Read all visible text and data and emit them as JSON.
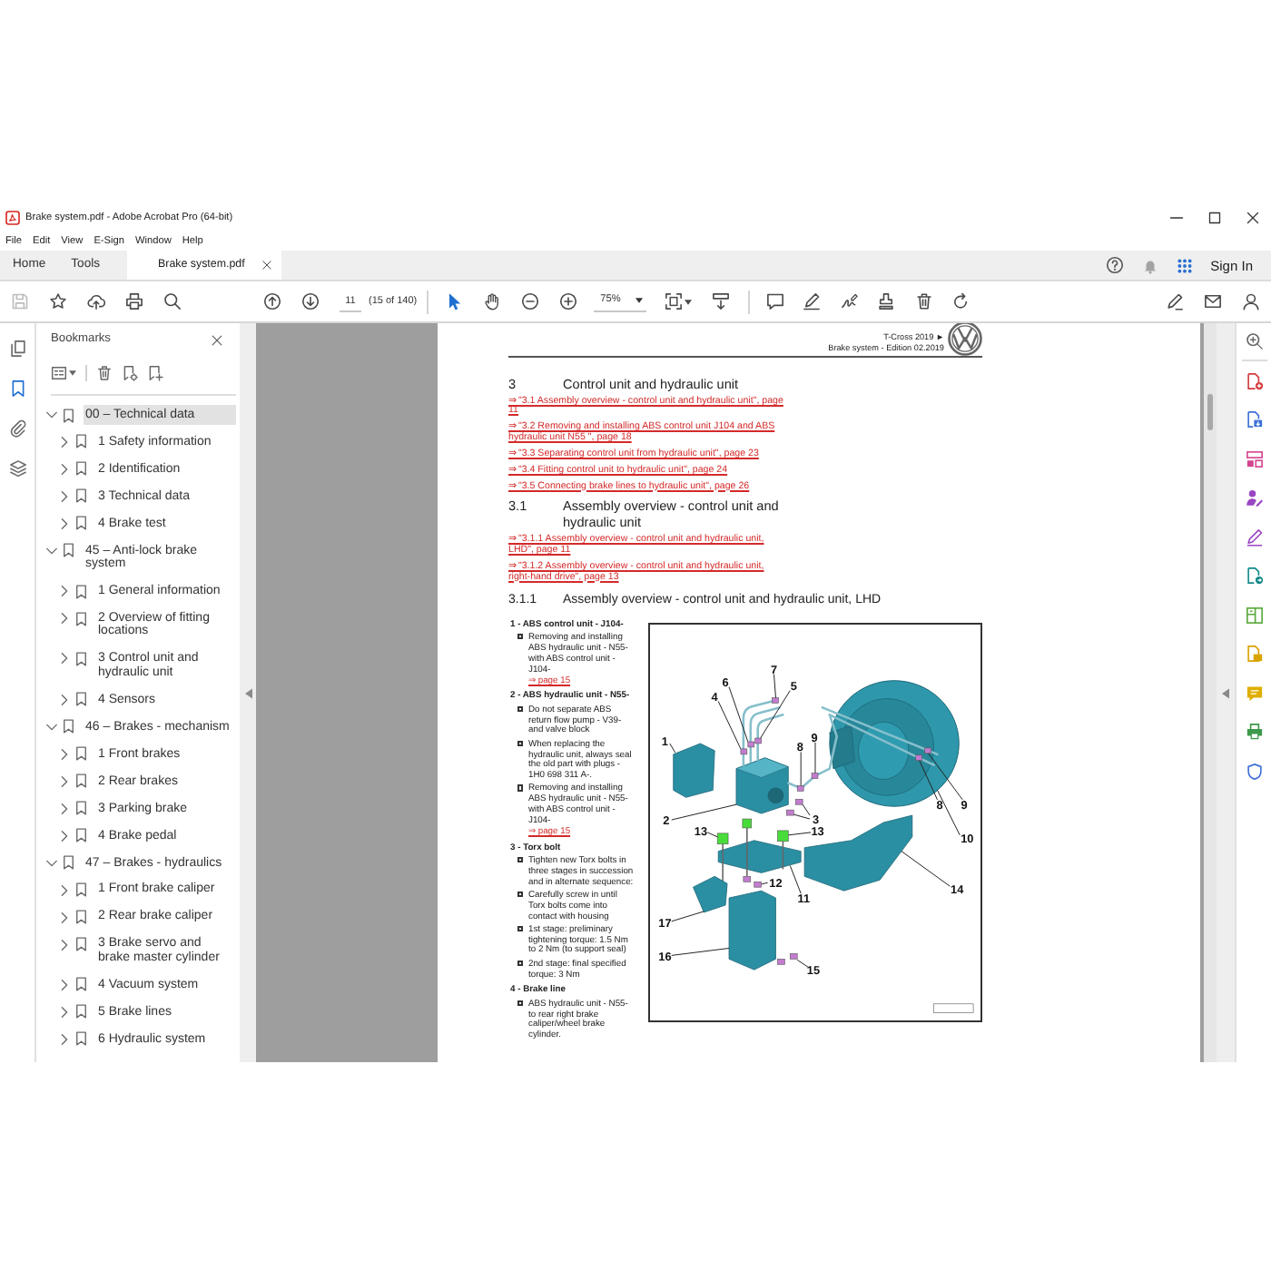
{
  "window": {
    "title": "Brake system.pdf - Adobe Acrobat Pro (64-bit)"
  },
  "menu": [
    "File",
    "Edit",
    "View",
    "E-Sign",
    "Window",
    "Help"
  ],
  "tabs": [
    {
      "label": "Home",
      "kind": "nav",
      "selected": false
    },
    {
      "label": "Tools",
      "kind": "nav",
      "selected": false
    },
    {
      "label": "Brake system.pdf",
      "kind": "document",
      "selected": true
    }
  ],
  "account": {
    "sign_in": "Sign In"
  },
  "toolbar": {
    "save": {
      "disabled": true
    },
    "page": {
      "current": "11",
      "count": "(15 of 140)"
    },
    "tools": {
      "select": {
        "selected": true
      },
      "hand": {
        "selected": false
      }
    },
    "zoom": "75%"
  },
  "side_rail": {
    "pages": {
      "selected": false
    },
    "bookmarks": {
      "selected": true
    },
    "attachments": {
      "selected": false
    },
    "layers": {
      "selected": false
    }
  },
  "bookmarks": {
    "title": "Bookmarks",
    "items": [
      {
        "label": "00 – Technical data",
        "selected": true,
        "expanded": true,
        "children": [
          {
            "label": "1 Safety information",
            "selected": false,
            "expanded": false
          },
          {
            "label": "2 Identification",
            "selected": false,
            "expanded": false
          },
          {
            "label": "3 Technical data",
            "selected": false,
            "expanded": false
          },
          {
            "label": "4 Brake test",
            "selected": false,
            "expanded": false
          }
        ]
      },
      {
        "label": "45 – Anti-lock brake system",
        "selected": false,
        "expanded": true,
        "children": [
          {
            "label": "1 General information",
            "selected": false,
            "expanded": false
          },
          {
            "label": "2 Overview of fitting locations",
            "selected": false,
            "expanded": false
          },
          {
            "label": "3 Control unit and hydraulic unit",
            "selected": false,
            "expanded": false
          },
          {
            "label": "4 Sensors",
            "selected": false,
            "expanded": false
          }
        ]
      },
      {
        "label": "46 – Brakes - mechanism",
        "selected": false,
        "expanded": true,
        "children": [
          {
            "label": "1 Front brakes",
            "selected": false,
            "expanded": false
          },
          {
            "label": "2 Rear brakes",
            "selected": false,
            "expanded": false
          },
          {
            "label": "3 Parking brake",
            "selected": false,
            "expanded": false
          },
          {
            "label": "4 Brake pedal",
            "selected": false,
            "expanded": false
          }
        ]
      },
      {
        "label": "47 – Brakes - hydraulics",
        "selected": false,
        "expanded": true,
        "children": [
          {
            "label": "1 Front brake caliper",
            "selected": false,
            "expanded": false
          },
          {
            "label": "2 Rear brake caliper",
            "selected": false,
            "expanded": false
          },
          {
            "label": "3 Brake servo and brake master cylinder",
            "selected": false,
            "expanded": false
          },
          {
            "label": "4 Vacuum system",
            "selected": false,
            "expanded": false
          },
          {
            "label": "5 Brake lines",
            "selected": false,
            "expanded": false
          },
          {
            "label": "6 Hydraulic system",
            "selected": false,
            "expanded": false
          }
        ]
      }
    ]
  },
  "document": {
    "header": {
      "model": "T-Cross 2019 ►",
      "edition": "Brake system - Edition 02.2019"
    },
    "blocks": [
      {
        "kind": "section_heading",
        "number": "3",
        "text": "Control unit and hydraulic unit"
      },
      {
        "kind": "link",
        "text": "⇒ \"3.1 Assembly overview - control unit and hydraulic unit\", page 11"
      },
      {
        "kind": "link",
        "text": "⇒ \"3.2 Removing and installing ABS control unit J104 and ABS hydraulic unit N55 \", page 18"
      },
      {
        "kind": "link",
        "text": "⇒ \"3.3 Separating control unit from hydraulic unit\", page 23"
      },
      {
        "kind": "link",
        "text": "⇒ \"3.4 Fitting control unit to hydraulic unit\", page 24"
      },
      {
        "kind": "link",
        "text": "⇒ \"3.5 Connecting brake lines to hydraulic unit\", page 26"
      },
      {
        "kind": "section_heading",
        "number": "3.1",
        "text": "Assembly overview - control unit and hydraulic unit"
      },
      {
        "kind": "link",
        "text": "⇒ \"3.1.1 Assembly overview - control unit and hydraulic unit, LHD\", page 11"
      },
      {
        "kind": "link",
        "text": "⇒ \"3.1.2 Assembly overview - control unit and hydraulic unit, right-hand drive\", page 13"
      },
      {
        "kind": "figure_heading",
        "number": "3.1.1",
        "text": "Assembly overview - control unit and hydraulic unit, LHD"
      }
    ],
    "legend": [
      {
        "title": "1 - ABS control unit - J104-",
        "notes": [
          {
            "text": "Removing and installing ABS hydraulic unit - N55- with ABS control unit - J104-",
            "link": "⇒ page 15"
          }
        ]
      },
      {
        "title": "2 - ABS hydraulic unit - N55-",
        "notes": [
          {
            "text": "Do not separate ABS return flow pump - V39- and valve block"
          },
          {
            "text": "When replacing the hydraulic unit, always seal the old part with plugs - 1H0 698 311 A-."
          },
          {
            "text": "Removing and installing ABS hydraulic unit - N55- with ABS control unit - J104-",
            "link": "⇒ page 15"
          }
        ]
      },
      {
        "title": "3 - Torx bolt",
        "notes": [
          {
            "text": "Tighten new Torx bolts in three stages in succession and in alternate sequence:"
          },
          {
            "text": "Carefully screw in until Torx bolts come into contact with housing"
          },
          {
            "text": "1st stage: preliminary tightening torque: 1.5 Nm to 2 Nm (to support seal)"
          },
          {
            "text": "2nd stage: final specified torque: 3 Nm"
          }
        ]
      },
      {
        "title": "4 - Brake line",
        "notes": [
          {
            "text": "ABS hydraulic unit - N55- to rear right brake caliper/wheel brake cylinder."
          }
        ]
      }
    ],
    "figure": {
      "callouts": [
        "7",
        "6",
        "5",
        "4",
        "9",
        "1",
        "8",
        "8",
        "9",
        "3",
        "2",
        "13",
        "13",
        "10",
        "12",
        "14",
        "11",
        "17",
        "16",
        "15"
      ]
    }
  }
}
